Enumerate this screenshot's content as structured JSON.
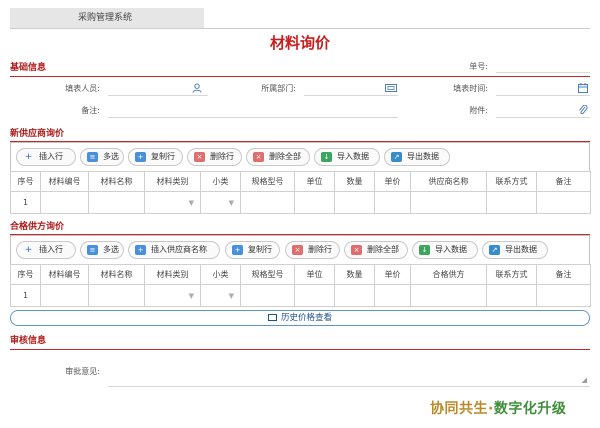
{
  "tab": {
    "label": "采购管理系统"
  },
  "page": {
    "title": "材料询价"
  },
  "basic": {
    "section_title": "基础信息",
    "fields": {
      "doc_no": "单号:",
      "filler": "填表人员:",
      "department": "所属部门:",
      "fill_time": "填表时间:",
      "remark": "备注:",
      "attachment": "附件:"
    }
  },
  "buttons": {
    "insert_row": "插入行",
    "multi_select": "多选",
    "copy_row": "复制行",
    "delete_row": "删除行",
    "delete_all": "删除全部",
    "import_data": "导入数据",
    "export_data": "导出数据",
    "insert_supplier": "插入供应商名称"
  },
  "new_supplier": {
    "section_title": "新供应商询价",
    "columns": [
      "序号",
      "材料编号",
      "材料名称",
      "材料类别",
      "小类",
      "规格型号",
      "单位",
      "数量",
      "单价",
      "供应商名称",
      "联系方式",
      "备注"
    ],
    "rows": [
      [
        "1",
        "",
        "",
        "",
        "",
        "",
        "",
        "",
        "",
        "",
        "",
        ""
      ]
    ]
  },
  "qualified_supplier": {
    "section_title": "合格供方询价",
    "columns": [
      "序号",
      "材料编号",
      "材料名称",
      "材料类别",
      "小类",
      "规格型号",
      "单位",
      "数量",
      "单价",
      "合格供方",
      "联系方式",
      "备注"
    ],
    "rows": [
      [
        "1",
        "",
        "",
        "",
        "",
        "",
        "",
        "",
        "",
        "",
        "",
        ""
      ]
    ]
  },
  "history": {
    "label": "历史价格查看"
  },
  "approval": {
    "section_title": "审核信息",
    "opinion_label": "审批意见:"
  },
  "brand": {
    "part1": "协同共生·",
    "part2": "数字化升级"
  },
  "icons": {
    "user": "user-icon",
    "org": "org-icon",
    "calendar": "calendar-icon",
    "attach": "paperclip-icon"
  },
  "colors": {
    "accent_red": "#c62828",
    "accent_blue": "#2f6fd6"
  }
}
